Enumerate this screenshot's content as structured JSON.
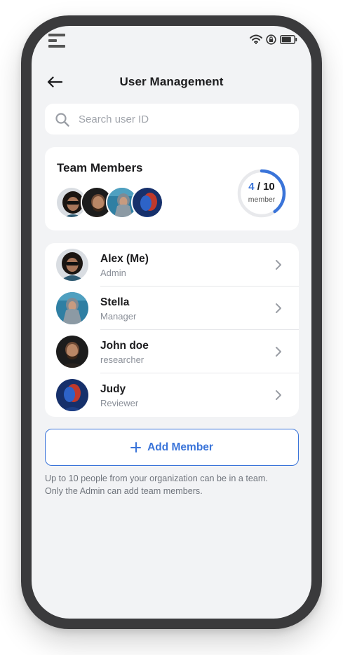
{
  "header": {
    "title": "User Management",
    "back_icon": "arrow-left-icon"
  },
  "search": {
    "placeholder": "Search user ID",
    "value": "",
    "icon": "search-icon"
  },
  "team": {
    "title": "Team Members",
    "current": "4",
    "separator": "/",
    "max": "10",
    "unit_label": "member",
    "fill_fraction": 0.4,
    "accent_color": "#3a74d9"
  },
  "members": [
    {
      "name": "Alex (Me)",
      "role": "Admin"
    },
    {
      "name": "Stella",
      "role": "Manager"
    },
    {
      "name": "John doe",
      "role": "researcher"
    },
    {
      "name": "Judy",
      "role": "Reviewer"
    }
  ],
  "add_member": {
    "label": "Add Member",
    "icon": "plus-icon"
  },
  "note": {
    "line1": "Up to 10 people from your organization can be in a team.",
    "line2": "Only the Admin can add team members."
  },
  "status_icons": [
    "wifi-icon",
    "lock-rotation-icon",
    "battery-icon"
  ]
}
